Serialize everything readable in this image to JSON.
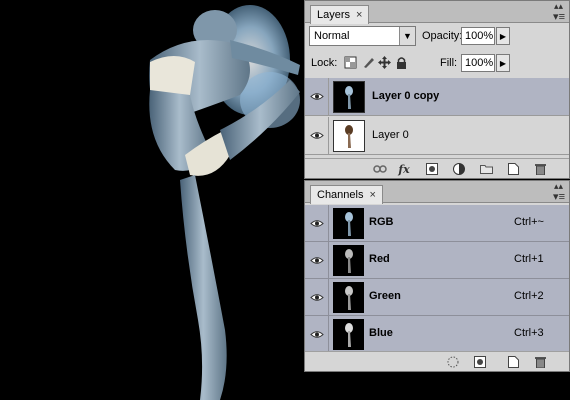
{
  "layers_panel": {
    "tab_label": "Layers",
    "blend_mode": "Normal",
    "opacity_label": "Opacity:",
    "opacity_value": "100%",
    "lock_label": "Lock:",
    "fill_label": "Fill:",
    "fill_value": "100%",
    "layers": [
      {
        "name": "Layer 0 copy",
        "selected": true,
        "visible": true
      },
      {
        "name": "Layer 0",
        "selected": false,
        "visible": true
      }
    ],
    "footer_icons": [
      "link-layers-icon",
      "fx-icon",
      "mask-icon",
      "adjustment-icon",
      "group-folder-icon",
      "new-layer-icon",
      "trash-icon"
    ],
    "fx_glyph": "fx"
  },
  "channels_panel": {
    "tab_label": "Channels",
    "channels": [
      {
        "name": "RGB",
        "shortcut": "Ctrl+~"
      },
      {
        "name": "Red",
        "shortcut": "Ctrl+1"
      },
      {
        "name": "Green",
        "shortcut": "Ctrl+2"
      },
      {
        "name": "Blue",
        "shortcut": "Ctrl+3"
      }
    ],
    "footer_icons": [
      "load-selection-icon",
      "save-selection-icon",
      "new-channel-icon",
      "trash-icon"
    ]
  },
  "colors": {
    "panel_bg": "#d6d6d6",
    "selected_row": "#b0b4c3",
    "canvas_bg": "#000000"
  }
}
